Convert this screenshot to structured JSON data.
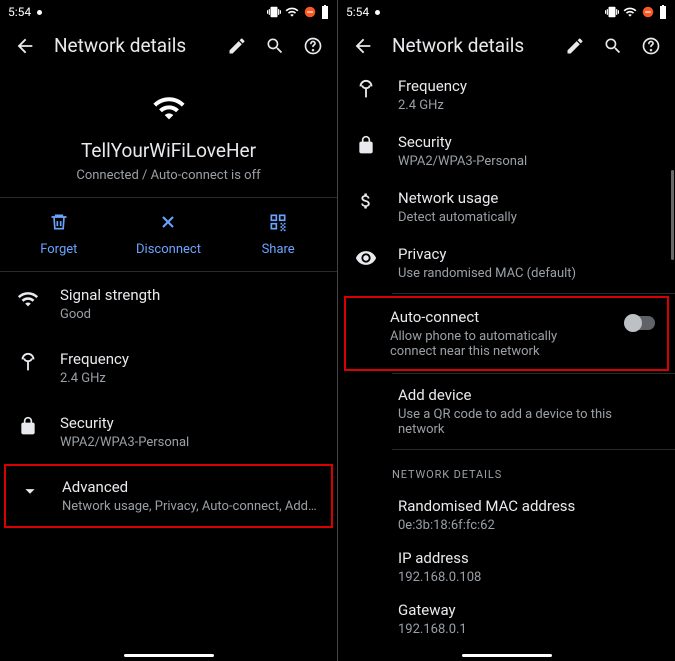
{
  "left": {
    "statusbar": {
      "time": "5:54"
    },
    "appbar": {
      "title": "Network details"
    },
    "network": {
      "name": "TellYourWiFiLoveHer",
      "status": "Connected / Auto-connect is off"
    },
    "actions": {
      "forget": "Forget",
      "disconnect": "Disconnect",
      "share": "Share"
    },
    "items": {
      "signal": {
        "title": "Signal strength",
        "sub": "Good"
      },
      "frequency": {
        "title": "Frequency",
        "sub": "2.4 GHz"
      },
      "security": {
        "title": "Security",
        "sub": "WPA2/WPA3-Personal"
      },
      "advanced": {
        "title": "Advanced",
        "sub": "Network usage, Privacy, Auto-connect, Add dev..."
      }
    }
  },
  "right": {
    "statusbar": {
      "time": "5:54"
    },
    "appbar": {
      "title": "Network details"
    },
    "items": {
      "frequency": {
        "title": "Frequency",
        "sub": "2.4 GHz"
      },
      "security": {
        "title": "Security",
        "sub": "WPA2/WPA3-Personal"
      },
      "usage": {
        "title": "Network usage",
        "sub": "Detect automatically"
      },
      "privacy": {
        "title": "Privacy",
        "sub": "Use randomised MAC (default)"
      },
      "autoconnect": {
        "title": "Auto-connect",
        "sub": "Allow phone to automatically connect near this network"
      },
      "adddevice": {
        "title": "Add device",
        "sub": "Use a QR code to add a device to this network"
      }
    },
    "section": "NETWORK DETAILS",
    "details": {
      "mac": {
        "title": "Randomised MAC address",
        "sub": "0e:3b:18:6f:fc:62"
      },
      "ip": {
        "title": "IP address",
        "sub": "192.168.0.108"
      },
      "gateway": {
        "title": "Gateway",
        "sub": "192.168.0.1"
      }
    }
  }
}
